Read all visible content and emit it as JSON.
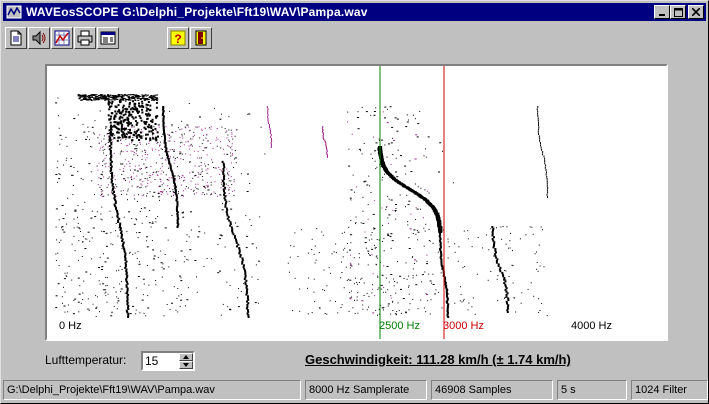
{
  "window": {
    "title": "WAVEosSCOPE  G:\\Delphi_Projekte\\Fft19\\WAV\\Pampa.wav"
  },
  "toolbar": {
    "buttons": [
      {
        "icon": "open-file-icon"
      },
      {
        "icon": "speaker-icon"
      },
      {
        "icon": "chart-grid-icon"
      },
      {
        "icon": "print-icon"
      },
      {
        "icon": "window-icon"
      },
      {
        "icon": "help-icon"
      },
      {
        "icon": "exit-door-icon"
      }
    ]
  },
  "spectrogram": {
    "labels": {
      "f0": "0 Hz",
      "f1": "2500 Hz",
      "f2": "3000 Hz",
      "f3": "4000 Hz"
    },
    "markers": {
      "f1_color": "#008000",
      "f2_color": "#cc0000"
    }
  },
  "controls": {
    "temperature_label": "Lufttemperatur:",
    "temperature_value": "15",
    "speed_text": "Geschwindigkeit: 111.28 km/h (± 1.74 km/h)"
  },
  "statusbar": {
    "path": "G:\\Delphi_Projekte\\Fft19\\WAV\\Pampa.wav",
    "samplerate": "8000 Hz Samplerate",
    "samples": "46908 Samples",
    "duration": "5 s",
    "filter": "1024 Filter"
  }
}
